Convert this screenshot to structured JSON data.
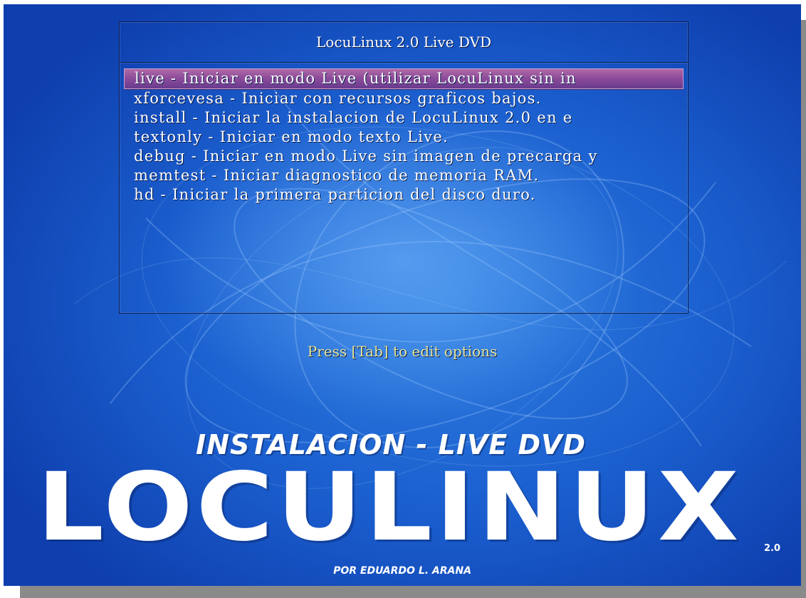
{
  "boot_menu": {
    "title": "LocuLinux 2.0 Live DVD",
    "selected_index": 0,
    "items": [
      {
        "label": "live - Iniciar en modo Live (utilizar LocuLinux sin in"
      },
      {
        "label": "xforcevesa - Iniciar con recursos graficos bajos."
      },
      {
        "label": "install - Iniciar la instalacion de LocuLinux 2.0 en e"
      },
      {
        "label": "textonly - Iniciar en modo texto Live."
      },
      {
        "label": "debug - Iniciar en modo Live sin imagen de precarga y"
      },
      {
        "label": "memtest - Iniciar diagnostico de memoria RAM."
      },
      {
        "label": "hd - Iniciar la primera particion del disco duro."
      }
    ],
    "hint": "Press [Tab] to edit options"
  },
  "branding": {
    "subtitle": "INSTALACION - LIVE DVD",
    "logo_text": "LOCULINUX",
    "version": "2.0",
    "author": "POR EDUARDO L. ARANA"
  },
  "colors": {
    "background": "#1b5fcf",
    "selection": "#8e4d9a",
    "hint": "#e6e49a",
    "text": "#ffffff"
  }
}
